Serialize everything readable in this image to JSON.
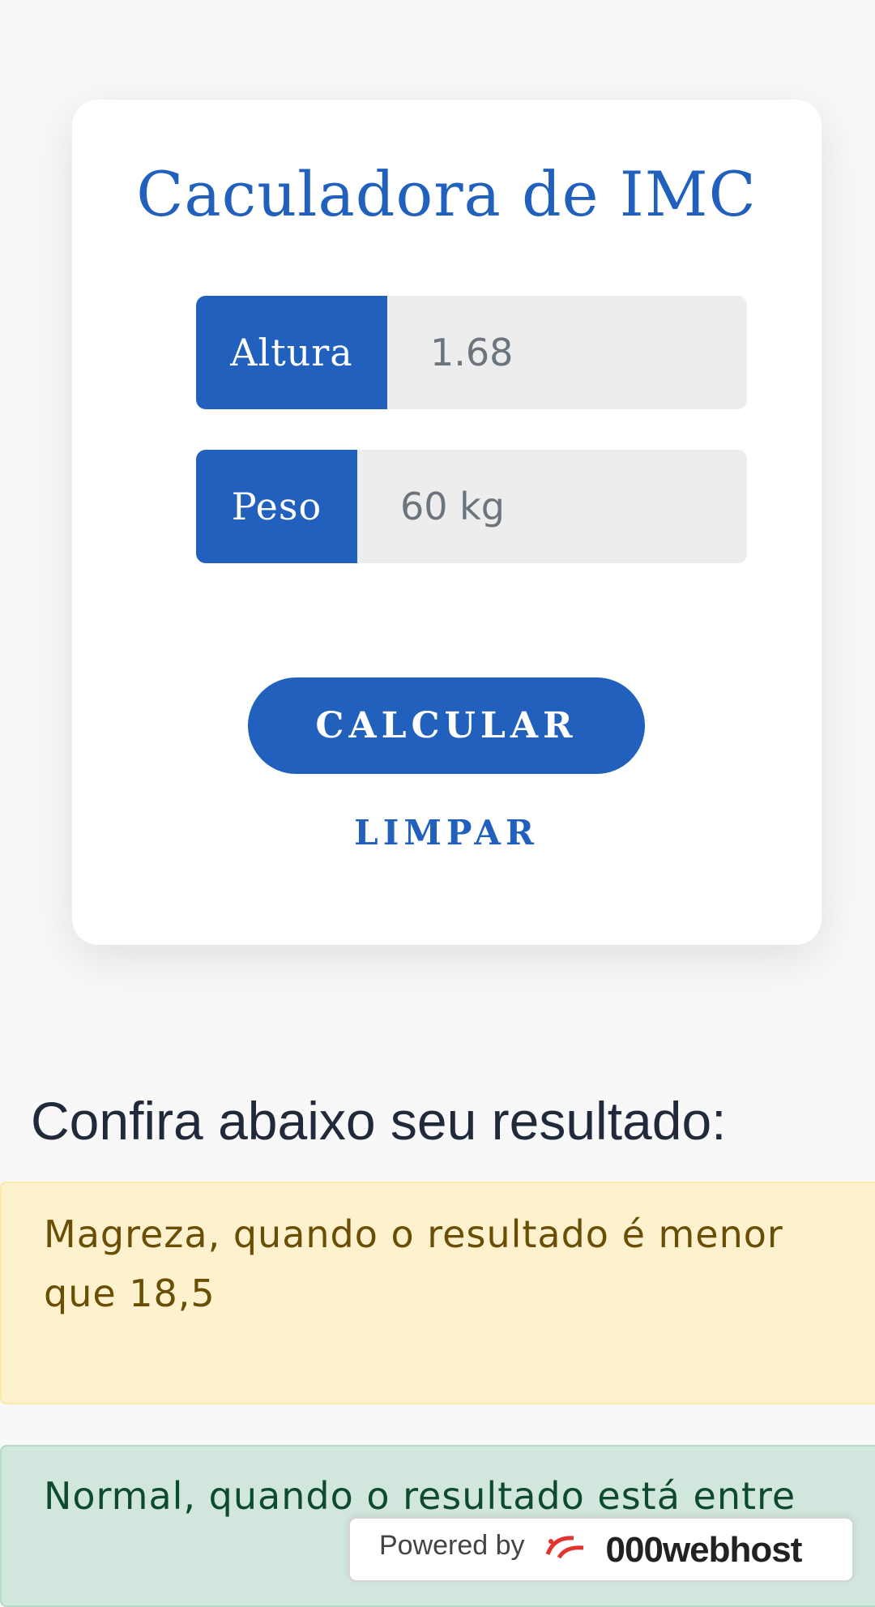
{
  "calculator": {
    "title": "Caculadora de IMC",
    "height_label": "Altura",
    "height_placeholder": "1.68",
    "weight_label": "Peso",
    "weight_placeholder": "60 kg",
    "calculate_label": "CALCULAR",
    "clear_label": "LIMPAR"
  },
  "results": {
    "heading": "Confira abaixo seu resultado:",
    "items": [
      {
        "text": "Magreza, quando o resultado é menor que 18,5",
        "status": "warning"
      },
      {
        "text": "Normal, quando o resultado está entre",
        "status": "success"
      }
    ]
  },
  "badge": {
    "prefix": "Powered by",
    "brand": "000webhost",
    "icon": "000webhost-logo-icon"
  },
  "colors": {
    "primary": "#2160bd",
    "warning_bg": "#fef1cd",
    "success_bg": "#d1e7dd"
  }
}
